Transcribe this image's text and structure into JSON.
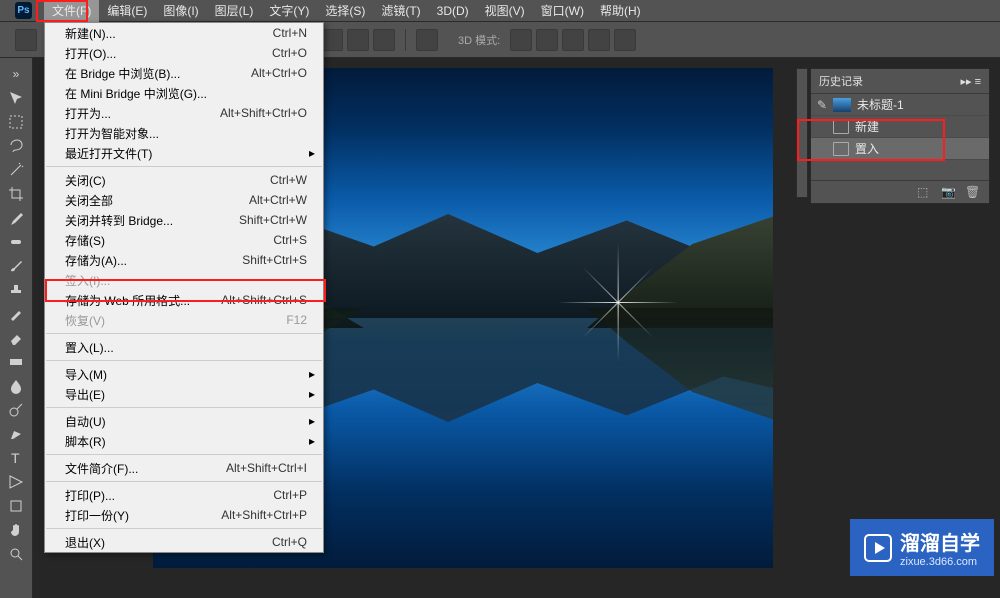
{
  "app": {
    "logo": "Ps"
  },
  "menubar": [
    {
      "label": "文件(F)",
      "active": true
    },
    {
      "label": "编辑(E)"
    },
    {
      "label": "图像(I)"
    },
    {
      "label": "图层(L)"
    },
    {
      "label": "文字(Y)"
    },
    {
      "label": "选择(S)"
    },
    {
      "label": "滤镜(T)"
    },
    {
      "label": "3D(D)"
    },
    {
      "label": "视图(V)"
    },
    {
      "label": "窗口(W)"
    },
    {
      "label": "帮助(H)"
    }
  ],
  "optionsbar": {
    "mode3d_label": "3D 模式:"
  },
  "dropdown": [
    {
      "label": "新建(N)...",
      "shortcut": "Ctrl+N"
    },
    {
      "label": "打开(O)...",
      "shortcut": "Ctrl+O"
    },
    {
      "label": "在 Bridge 中浏览(B)...",
      "shortcut": "Alt+Ctrl+O"
    },
    {
      "label": "在 Mini Bridge 中浏览(G)..."
    },
    {
      "label": "打开为...",
      "shortcut": "Alt+Shift+Ctrl+O"
    },
    {
      "label": "打开为智能对象..."
    },
    {
      "label": "最近打开文件(T)",
      "arrow": true
    },
    {
      "sep": true
    },
    {
      "label": "关闭(C)",
      "shortcut": "Ctrl+W"
    },
    {
      "label": "关闭全部",
      "shortcut": "Alt+Ctrl+W"
    },
    {
      "label": "关闭并转到 Bridge...",
      "shortcut": "Shift+Ctrl+W"
    },
    {
      "label": "存储(S)",
      "shortcut": "Ctrl+S"
    },
    {
      "label": "存储为(A)...",
      "shortcut": "Shift+Ctrl+S"
    },
    {
      "label": "签入(I)...",
      "disabled": true
    },
    {
      "label": "存储为 Web 所用格式...",
      "shortcut": "Alt+Shift+Ctrl+S"
    },
    {
      "label": "恢复(V)",
      "shortcut": "F12",
      "disabled": true
    },
    {
      "sep": true
    },
    {
      "label": "置入(L)..."
    },
    {
      "sep": true
    },
    {
      "label": "导入(M)",
      "arrow": true
    },
    {
      "label": "导出(E)",
      "arrow": true
    },
    {
      "sep": true
    },
    {
      "label": "自动(U)",
      "arrow": true
    },
    {
      "label": "脚本(R)",
      "arrow": true
    },
    {
      "sep": true
    },
    {
      "label": "文件简介(F)...",
      "shortcut": "Alt+Shift+Ctrl+I"
    },
    {
      "sep": true
    },
    {
      "label": "打印(P)...",
      "shortcut": "Ctrl+P"
    },
    {
      "label": "打印一份(Y)",
      "shortcut": "Alt+Shift+Ctrl+P"
    },
    {
      "sep": true
    },
    {
      "label": "退出(X)",
      "shortcut": "Ctrl+Q"
    }
  ],
  "history": {
    "title": "历史记录",
    "snapshot": "未标题-1",
    "states": [
      {
        "label": "新建"
      },
      {
        "label": "置入",
        "selected": true
      }
    ]
  },
  "watermark": {
    "title": "溜溜自学",
    "subtitle": "zixue.3d66.com"
  }
}
